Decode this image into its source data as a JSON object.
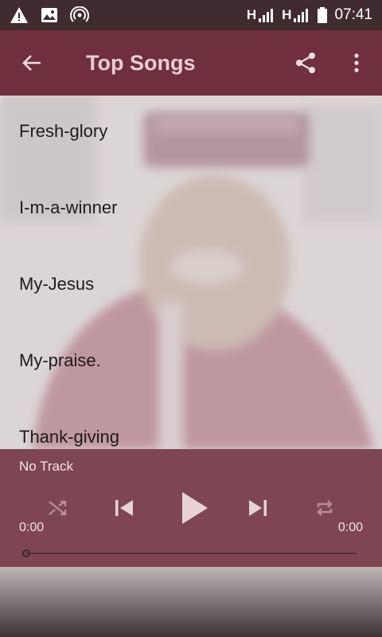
{
  "status_bar": {
    "network_left": "H",
    "network_right": "H",
    "time": "07:41"
  },
  "app_bar": {
    "title": "Top Songs",
    "icons": [
      "arrow-left-icon",
      "share-icon",
      "more-vert-icon"
    ]
  },
  "songs": [
    "Fresh-glory",
    "I-m-a-winner",
    "My-Jesus",
    "My-praise.",
    "Thank-giving"
  ],
  "player": {
    "track_title": "No Track",
    "time_elapsed": "0:00",
    "time_total": "0:00",
    "progress": 0,
    "icons": [
      "shuffle-icon",
      "skip-previous-icon",
      "play-icon",
      "skip-next-icon",
      "repeat-icon"
    ]
  },
  "colors": {
    "status_bar": "#3f2b30",
    "app_bar": "#6f2f3c",
    "player": "#844858"
  }
}
